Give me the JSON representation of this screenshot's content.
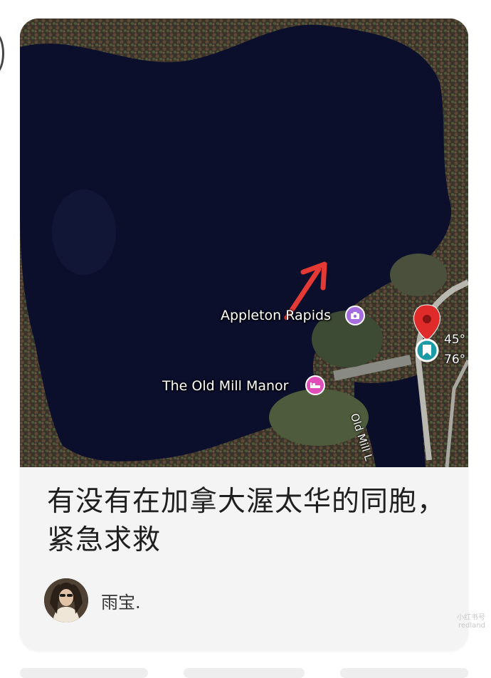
{
  "post": {
    "title": "有没有在加拿大渥太华的同胞，紧急求救",
    "author": "雨宝."
  },
  "map": {
    "labels": {
      "appleton": "Appleton Rapids",
      "manor": "The Old Mill Manor",
      "road": "Old Mill L",
      "temp_1": "45°",
      "temp_2": "76°"
    },
    "icons": {
      "camera_pin": "camera-icon",
      "hotel_pin": "bed-icon",
      "location_pin": "location-pin-icon",
      "marker_pin": "bookmark-icon",
      "arrow": "arrow-annotation-icon"
    }
  },
  "watermark": {
    "line1": "小红书号",
    "line2": "redland"
  },
  "colors": {
    "water": "#0b0f2c",
    "card_bg": "#f4f4f4",
    "title": "#1f1f1f",
    "pin_red": "#e02b2b",
    "arrow_red": "#e53935"
  }
}
